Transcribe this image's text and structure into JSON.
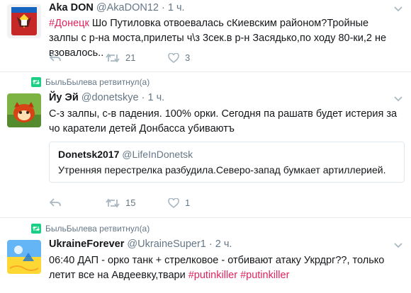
{
  "tweets": [
    {
      "name": "Aka DON",
      "handle": "@AkaDON12",
      "time": "1 ч.",
      "hashtag": "#Донецк",
      "text": " Шо Путиловка отвоевалась сКиевским районом?Тройные залпы с р-на моста,прилеты ч\\з 3сек.в р-н Засядько,по ходу 80-ки,2 не взовалось..",
      "retweets": "21",
      "likes": "3"
    },
    {
      "retweeted_by": "БыльБылева ретвитнул(а)",
      "name": "Йу Эй",
      "handle": "@donetskye",
      "time": "1 ч.",
      "text": "С-з залпы, с-в падения. 100% орки. Сегодня па рашатв будет истерия за чо каратели детей Донбасса убиваютъ",
      "quote": {
        "name": "Donetsk2017",
        "handle": "@LifeInDonetsk",
        "text": "Утренняя перестрелка разбудила.Северо-запад бумкает артиллерией."
      },
      "retweets": "15",
      "likes": "1"
    },
    {
      "retweeted_by": "БыльБылева ретвитнул(а)",
      "name": "UkraineForever",
      "handle": "@UkraineSuper1",
      "time": "2 ч.",
      "text": "06:40 ДАП - орко танк + стрелковое - отбивают атаку Укрдрг??, только летит все на Авдеевку,твари ",
      "hashtags": [
        "#putinkiller",
        "#putinkiller"
      ]
    }
  ],
  "colors": {
    "hashtag": "#e0245e",
    "secondary_text": "#657786",
    "retweet_green": "#19cf86",
    "divider": "#e6ecf0"
  },
  "icons": [
    "reply-icon",
    "retweet-icon",
    "like-icon",
    "chevron-down-icon",
    "retweeted-icon"
  ]
}
